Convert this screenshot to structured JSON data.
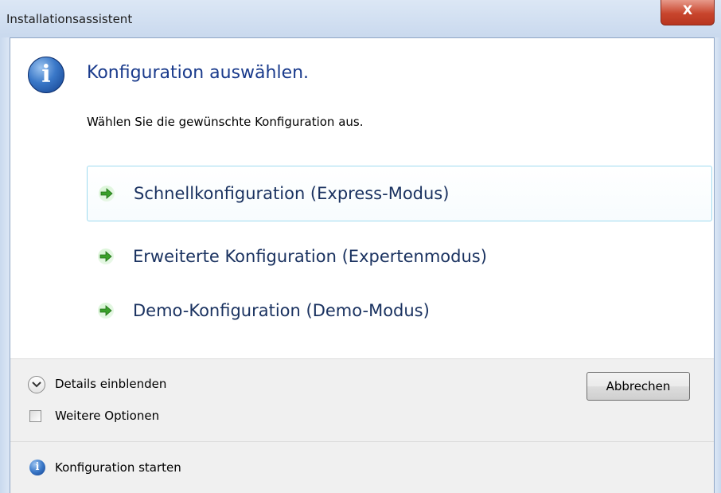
{
  "window": {
    "title": "Installationsassistent",
    "close_label": "X"
  },
  "header": {
    "info_icon": "information-icon",
    "heading": "Konfiguration auswählen.",
    "subtext": "Wählen Sie die gewünschte Konfiguration aus."
  },
  "options": [
    {
      "label": "Schnellkonfiguration (Express-Modus)",
      "icon": "green-arrow-icon",
      "highlighted": true
    },
    {
      "label": "Erweiterte Konfiguration (Expertenmodus)",
      "icon": "green-arrow-icon",
      "highlighted": false
    },
    {
      "label": "Demo-Konfiguration (Demo-Modus)",
      "icon": "green-arrow-icon",
      "highlighted": false
    }
  ],
  "bottom": {
    "details_label": "Details einblenden",
    "weitere_label": "Weitere Optionen",
    "weitere_checked": false,
    "cancel_label": "Abbrechen"
  },
  "footer": {
    "label": "Konfiguration starten",
    "icon": "information-icon"
  },
  "colors": {
    "heading": "#1a3b8c",
    "option_text": "#1a3260",
    "arrow": "#3aa02a",
    "highlight_border": "#9fdbf0",
    "close_button": "#c8452d"
  }
}
